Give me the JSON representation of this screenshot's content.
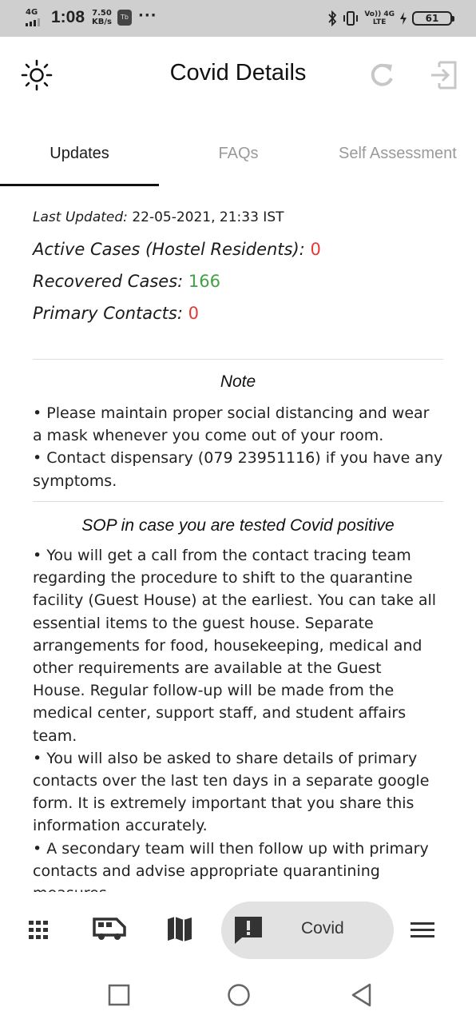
{
  "status_bar": {
    "network": "4G",
    "time": "1:08",
    "speed_value": "7.50",
    "speed_unit": "KB/s",
    "notif_label": "Tb",
    "more": "···",
    "volte_top": "Vo)) 4G",
    "volte_bottom": "LTE",
    "battery": "61"
  },
  "app_bar": {
    "title": "Covid Details",
    "icons": [
      "brightness-icon",
      "refresh-icon",
      "exit-icon"
    ]
  },
  "tabs": {
    "items": [
      {
        "label": "Updates"
      },
      {
        "label": "FAQs"
      },
      {
        "label": "Self Assessment"
      }
    ],
    "active_index": 0
  },
  "updates": {
    "last_updated_label": "Last Updated:",
    "last_updated_value": "22-05-2021, 21:33 IST",
    "active_label": "Active Cases (Hostel Residents):",
    "active_value": "0",
    "recovered_label": "Recovered Cases:",
    "recovered_value": "166",
    "primary_label": "Primary Contacts:",
    "primary_value": "0"
  },
  "note": {
    "title": "Note",
    "lines": [
      "• Please maintain proper social distancing and wear",
      "a mask whenever you come out of your room.",
      "• Contact dispensary (079 23951116) if you have any",
      "symptoms."
    ]
  },
  "sop": {
    "title": "SOP in case you are tested Covid positive",
    "lines": [
      "• You will get a call from the contact tracing team",
      "regarding the procedure to shift to the quarantine",
      "facility (Guest House) at the earliest. You can take all",
      "essential items to the guest house. Separate",
      "arrangements for food, housekeeping, medical and",
      "other requirements are available at the Guest",
      "House. Regular follow-up will be made from the",
      "medical center, support staff, and student affairs",
      "team.",
      "• You will also be asked to share details of primary",
      "contacts over the last ten days in a separate google",
      "form. It is extremely important that you share this",
      "information accurately.",
      "• A secondary team will then follow up with primary",
      "contacts and advise appropriate quarantining",
      "measures."
    ]
  },
  "bottom_nav": {
    "items": [
      "grid-icon",
      "bus-icon",
      "map-icon",
      "alert-icon",
      "menu-icon"
    ],
    "active_label": "Covid"
  },
  "colors": {
    "red": "#e53935",
    "green": "#43a047",
    "pill_bg": "#e2e2e2",
    "status_bar_bg": "#cfcfcf"
  }
}
